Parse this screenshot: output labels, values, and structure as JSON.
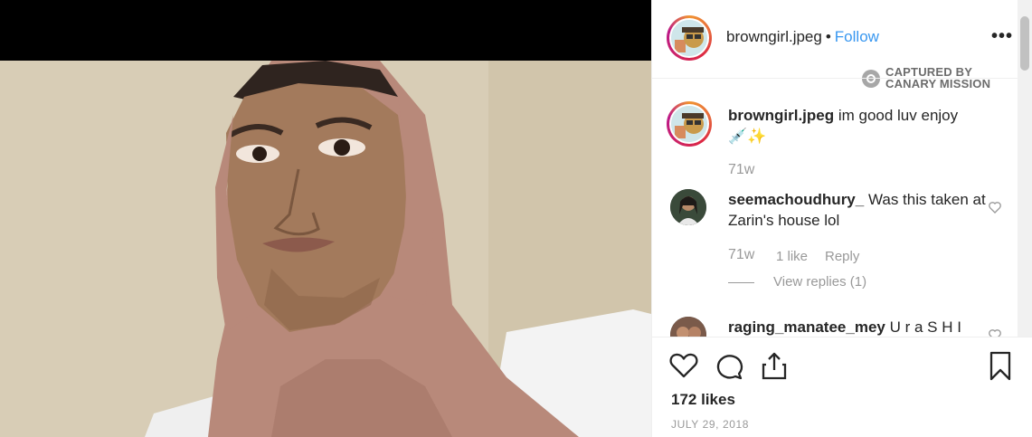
{
  "post": {
    "username": "browngirl.jpeg",
    "separator": "•",
    "follow_label": "Follow",
    "more_label": "•••"
  },
  "watermark": {
    "line1": "CAPTURED BY",
    "line2": "CANARY MISSION"
  },
  "caption": {
    "username": "browngirl.jpeg",
    "text": " im good luv enjoy",
    "emoji": "💉✨",
    "time": "71w"
  },
  "comments": [
    {
      "username": "seemachoudhury_",
      "text": " Was this taken at Zarin's house lol",
      "time": "71w",
      "likes": "1 like",
      "reply_label": "Reply",
      "view_replies": "View replies (1)"
    },
    {
      "username": "raging_manatee_mey",
      "text": " U r a S H I",
      "time": "",
      "likes": "",
      "reply_label": "",
      "view_replies": ""
    }
  ],
  "stats": {
    "likes": "172 likes",
    "date": "JULY 29, 2018"
  },
  "colors": {
    "link_blue": "#3897f0",
    "secondary_text": "#999999",
    "ring_gradient": [
      "#f09433",
      "#dc2743",
      "#bc1888"
    ],
    "hijab": "#b98a78"
  },
  "icons": [
    "heart-icon",
    "comment-icon",
    "share-icon",
    "bookmark-icon",
    "more-options-icon",
    "canary-mission-icon"
  ]
}
